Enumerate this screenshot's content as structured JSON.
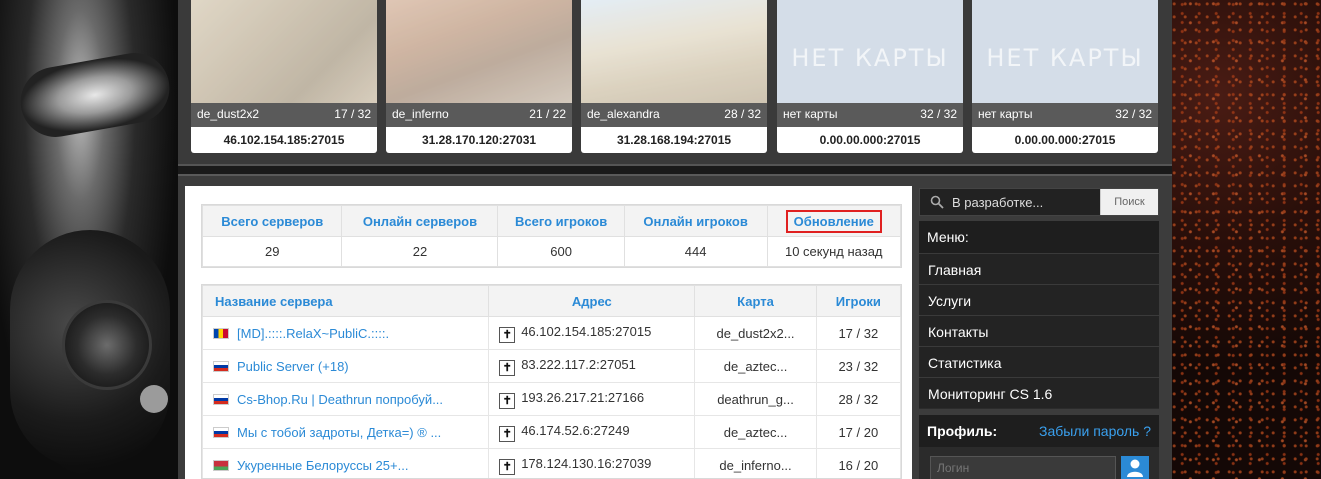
{
  "top_cards": [
    {
      "map": "de_dust2x2",
      "players": "17 / 32",
      "address": "46.102.154.185:27015",
      "image": "dust"
    },
    {
      "map": "de_inferno",
      "players": "21 / 22",
      "address": "31.28.170.120:27031",
      "image": "inferno"
    },
    {
      "map": "de_alexandra",
      "players": "28 / 32",
      "address": "31.28.168.194:27015",
      "image": "alex"
    },
    {
      "map": "нет карты",
      "players": "32 / 32",
      "address": "0.00.00.000:27015",
      "image": "nomap",
      "placeholder": "НЕТ КАРТЫ"
    },
    {
      "map": "нет карты",
      "players": "32 / 32",
      "address": "0.00.00.000:27015",
      "image": "nomap",
      "placeholder": "НЕТ КАРТЫ"
    }
  ],
  "stats": {
    "headers": [
      "Всего серверов",
      "Онлайн серверов",
      "Всего игроков",
      "Онлайн игроков",
      "Обновление"
    ],
    "values": [
      "29",
      "22",
      "600",
      "444",
      "10 секунд назад"
    ]
  },
  "servers": {
    "headers": [
      "Название сервера",
      "Адрес",
      "Карта",
      "Игроки"
    ],
    "rows": [
      {
        "flag": "md",
        "name": "[MD].::::.RelaX~PublіC.::::.",
        "address": "46.102.154.185:27015",
        "map": "de_dust2x2...",
        "players": "17 / 32"
      },
      {
        "flag": "ru",
        "name": "Public Server (+18)",
        "address": "83.222.117.2:27051",
        "map": "de_aztec...",
        "players": "23 / 32"
      },
      {
        "flag": "ru",
        "name": "Cs-Bhop.Ru | Deathrun попробуй...",
        "address": "193.26.217.21:27166",
        "map": "deathrun_g...",
        "players": "28 / 32"
      },
      {
        "flag": "ru",
        "name": "Мы с тобой задроты, Детка=) ® ...",
        "address": "46.174.52.6:27249",
        "map": "de_aztec...",
        "players": "17 / 20"
      },
      {
        "flag": "by",
        "name": "Укуренные Белоруссы 25+...",
        "address": "178.124.130.16:27039",
        "map": "de_inferno...",
        "players": "16 / 20"
      }
    ]
  },
  "search": {
    "placeholder": "В разработке...",
    "button": "Поиск"
  },
  "menu": {
    "title": "Меню:",
    "items": [
      "Главная",
      "Услуги",
      "Контакты",
      "Статистика",
      "Мониторинг CS 1.6"
    ]
  },
  "profile": {
    "title": "Профиль:",
    "forgot": "Забыли пароль ?",
    "login_placeholder": "Логин"
  },
  "colors": {
    "accent": "#2b8ad6",
    "highlight": "#e02020"
  }
}
